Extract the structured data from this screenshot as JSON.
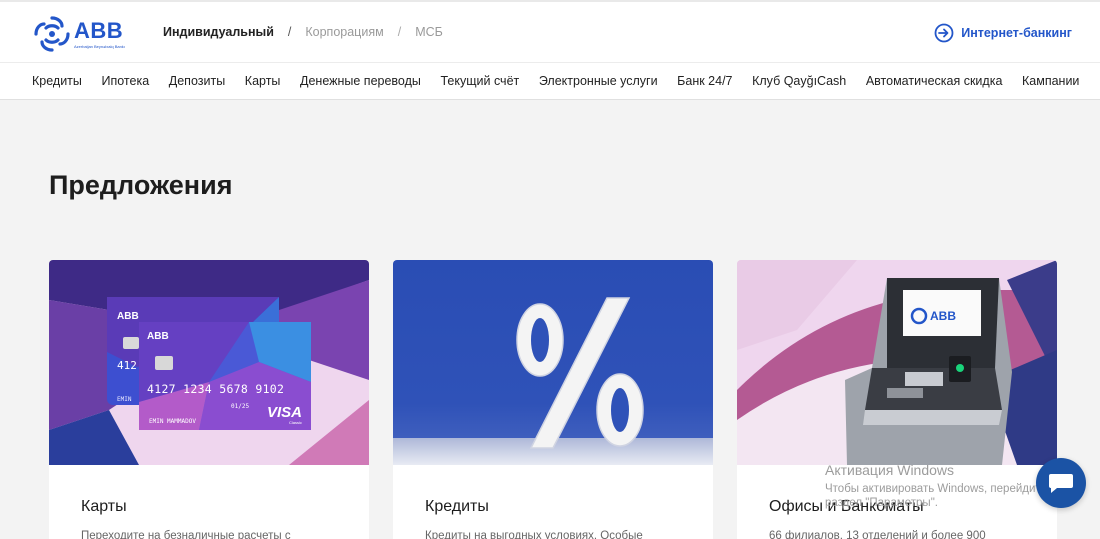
{
  "header": {
    "logo_text": "ABB",
    "logo_subtext": "Azerbaijan Beynəlxalq Bankı",
    "segments": [
      "Индивидуальный",
      "Корпорациям",
      "МСБ"
    ],
    "internet_banking": "Интернет-банкинг"
  },
  "nav": {
    "items": [
      "Кредиты",
      "Ипотека",
      "Депозиты",
      "Карты",
      "Денежные переводы",
      "Текущий счёт",
      "Электронные услуги",
      "Банк 24/7",
      "Клуб QayğıCash",
      "Автоматическая скидка",
      "Кампании"
    ]
  },
  "main": {
    "heading": "Предложения",
    "cards": [
      {
        "title": "Карты",
        "desc": "Переходите на безналичные расчеты с",
        "icon": "bank-cards-image"
      },
      {
        "title": "Кредиты",
        "desc": "Кредиты на выгодных условиях. Особые",
        "icon": "percent-image"
      },
      {
        "title": "Офисы и Банкоматы",
        "desc": "66 филиалов, 13 отделений и более 900",
        "icon": "atm-image"
      }
    ],
    "card_artwork": {
      "front_number": "4127 1234 5678 9102",
      "back_number_partial": "412",
      "expiry": "01/25",
      "holder_front": "EMIN MAMMADOV",
      "holder_back": "EMIN",
      "brand": "VISA",
      "brand_sub": "Classic",
      "logo": "ABB"
    },
    "atm_screen_logo": "ABB"
  },
  "watermark": {
    "line1": "Активация Windows",
    "line2": "Чтобы активировать Windows, перейдите в",
    "line3": "раздел \"Параметры\"."
  },
  "chat": {
    "icon": "chat-bubble-icon"
  },
  "colors": {
    "brand_blue": "#2356c9",
    "chat_blue": "#1b53a5"
  }
}
